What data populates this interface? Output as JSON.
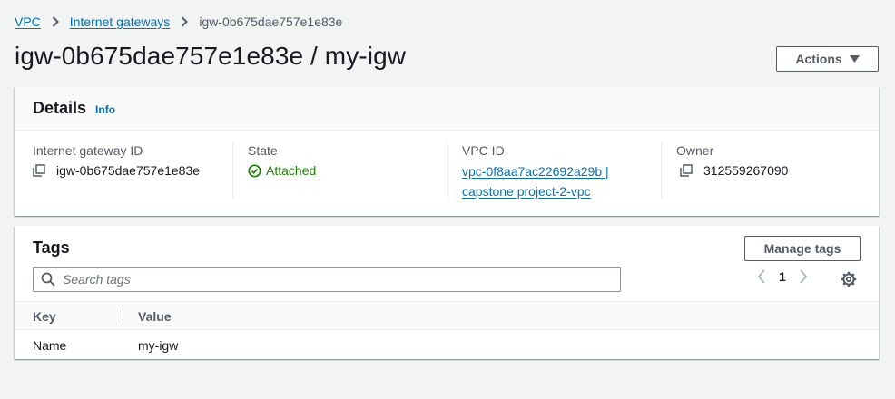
{
  "breadcrumb": {
    "items": [
      "VPC",
      "Internet gateways"
    ],
    "current": "igw-0b675dae757e1e83e"
  },
  "header": {
    "title": "igw-0b675dae757e1e83e / my-igw",
    "actions_label": "Actions"
  },
  "details": {
    "title": "Details",
    "info_label": "Info",
    "columns": [
      {
        "label": "Internet gateway ID",
        "value": "igw-0b675dae757e1e83e",
        "icon": "copy-icon"
      },
      {
        "label": "State",
        "value": "Attached",
        "icon": "check-circle-icon"
      },
      {
        "label": "VPC ID",
        "value_line1": "vpc-0f8aa7ac22692a29b |",
        "value_line2": "capstone project-2-vpc"
      },
      {
        "label": "Owner",
        "value": "312559267090",
        "icon": "copy-icon"
      }
    ]
  },
  "tags": {
    "title": "Tags",
    "manage_label": "Manage tags",
    "search_placeholder": "Search tags",
    "page": "1",
    "columns": [
      "Key",
      "Value"
    ],
    "rows": [
      {
        "key": "Name",
        "value": "my-igw"
      }
    ]
  },
  "colors": {
    "link": "#0073bb",
    "success": "#1d8102",
    "background": "#f2f3f3"
  }
}
